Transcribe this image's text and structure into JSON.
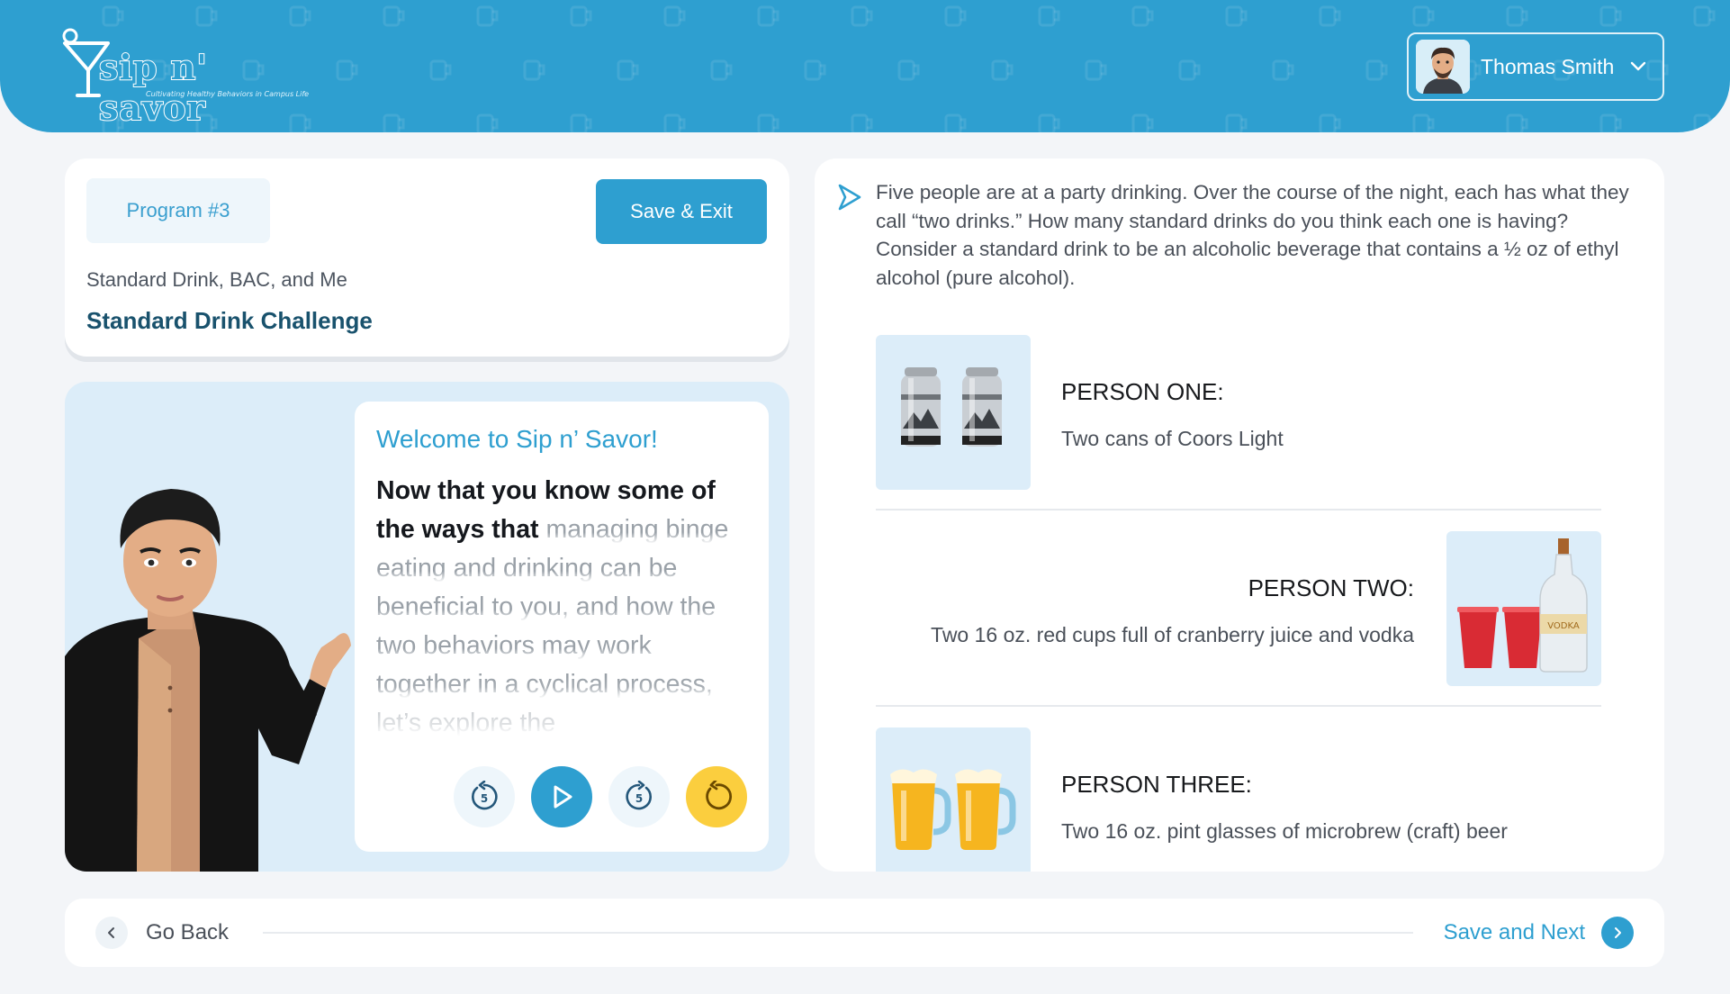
{
  "header": {
    "logo_text": "sip n' savor",
    "logo_tagline": "Cultivating Healthy Behaviors in Campus Life",
    "user_name": "Thomas Smith",
    "colors": {
      "brand": "#2e9fd0",
      "accent": "#fbce3e"
    }
  },
  "program": {
    "badge": "Program #3",
    "save_exit_label": "Save & Exit",
    "subtitle": "Standard Drink, BAC, and Me",
    "title": "Standard Drink Challenge"
  },
  "narration": {
    "title": "Welcome to Sip n’ Savor!",
    "read_text": "Now that you know some of the ways that",
    "unread_text": "managing binge eating and drinking can be beneficial to you, and how the two behaviors may work together in a cyclical process, let’s explore the",
    "controls": {
      "rewind_icon": "rewind-5-icon",
      "play_icon": "play-icon",
      "forward_icon": "forward-5-icon",
      "replay_icon": "replay-icon",
      "skip_seconds": "5"
    }
  },
  "question": {
    "text": "Five people are at a party drinking. Over the course of the night, each has what they call “two drinks.” How many standard drinks do you think each one is having? Consider a standard drink to be an alcoholic beverage that contains a ½ oz of ethyl alcohol (pure alcohol)."
  },
  "people": [
    {
      "name": "PERSON ONE:",
      "description": "Two cans of Coors Light",
      "image": "beer-cans"
    },
    {
      "name": "PERSON TWO:",
      "description": "Two 16 oz. red cups full of cranberry juice and vodka",
      "image": "red-cups-vodka",
      "bottle_label": "VODKA"
    },
    {
      "name": "PERSON THREE:",
      "description": "Two 16 oz. pint glasses of microbrew (craft) beer",
      "image": "beer-mugs"
    }
  ],
  "footer": {
    "back_label": "Go Back",
    "next_label": "Save and Next"
  }
}
